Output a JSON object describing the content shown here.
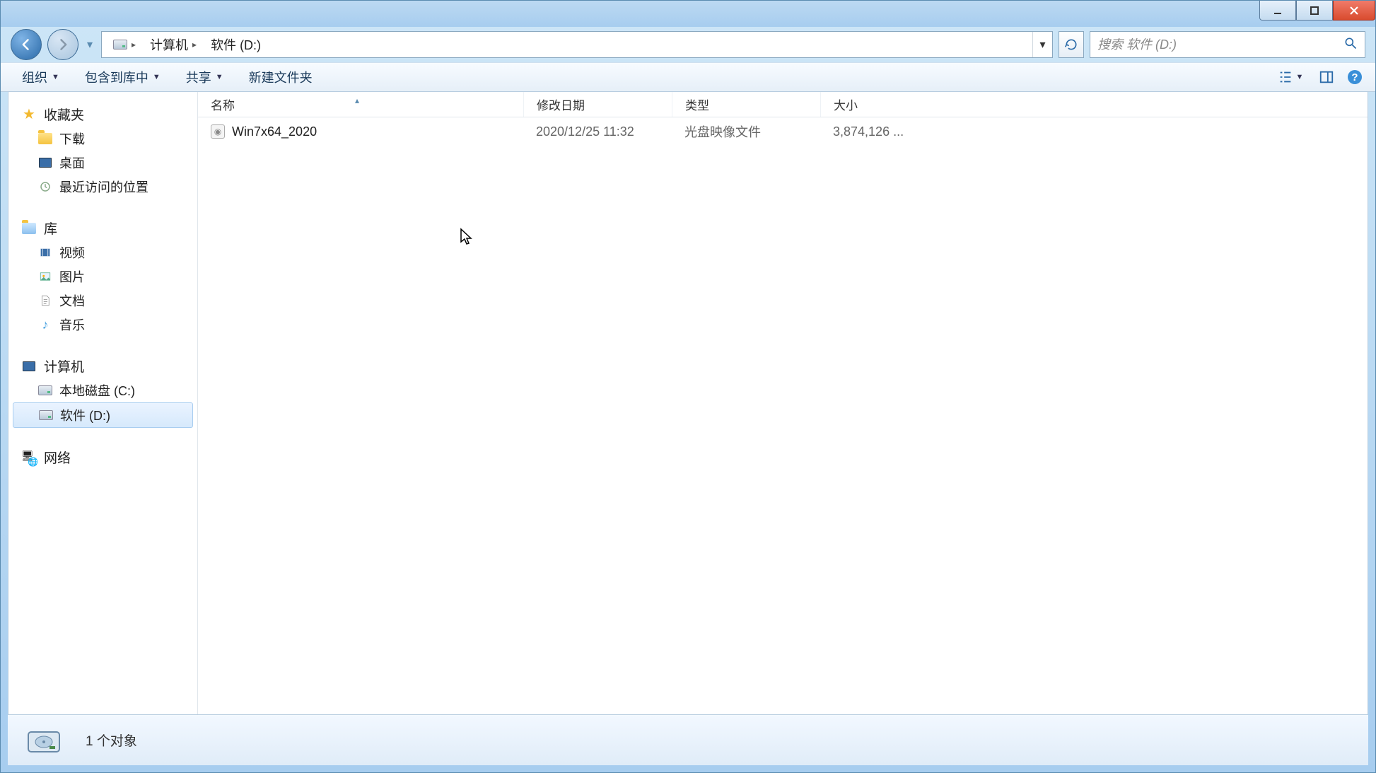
{
  "window": {
    "min_tip": "最小化",
    "max_tip": "最大化",
    "close_tip": "关闭"
  },
  "address": {
    "root": "计算机",
    "current": "软件 (D:)"
  },
  "search": {
    "placeholder": "搜索 软件 (D:)"
  },
  "toolbar": {
    "organize": "组织",
    "include": "包含到库中",
    "share": "共享",
    "new_folder": "新建文件夹"
  },
  "columns": {
    "name": "名称",
    "date": "修改日期",
    "type": "类型",
    "size": "大小"
  },
  "sidebar": {
    "favorites": {
      "label": "收藏夹"
    },
    "downloads": {
      "label": "下载"
    },
    "desktop": {
      "label": "桌面"
    },
    "recent": {
      "label": "最近访问的位置"
    },
    "libraries": {
      "label": "库"
    },
    "videos": {
      "label": "视频"
    },
    "pictures": {
      "label": "图片"
    },
    "documents": {
      "label": "文档"
    },
    "music": {
      "label": "音乐"
    },
    "computer": {
      "label": "计算机"
    },
    "local_c": {
      "label": "本地磁盘 (C:)"
    },
    "soft_d": {
      "label": "软件 (D:)"
    },
    "network": {
      "label": "网络"
    }
  },
  "files": [
    {
      "name": "Win7x64_2020",
      "date": "2020/12/25 11:32",
      "type": "光盘映像文件",
      "size": "3,874,126 ..."
    }
  ],
  "status": {
    "text": "1 个对象"
  }
}
